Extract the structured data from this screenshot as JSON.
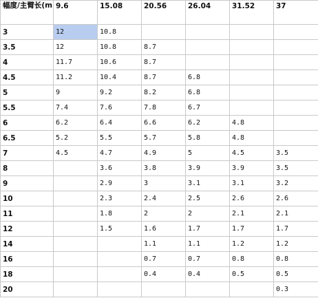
{
  "table": {
    "corner_label": "幅度/主臂长(m)",
    "columns": [
      "9.6",
      "15.08",
      "20.56",
      "26.04",
      "31.52",
      "37"
    ],
    "selected_cell": [
      0,
      0
    ],
    "rows": [
      {
        "label": "3",
        "cells": [
          "12",
          "10.8",
          "",
          "",
          "",
          ""
        ]
      },
      {
        "label": "3.5",
        "cells": [
          "12",
          "10.8",
          "8.7",
          "",
          "",
          ""
        ]
      },
      {
        "label": "4",
        "cells": [
          "11.7",
          "10.6",
          "8.7",
          "",
          "",
          ""
        ]
      },
      {
        "label": "4.5",
        "cells": [
          "11.2",
          "10.4",
          "8.7",
          "6.8",
          "",
          ""
        ]
      },
      {
        "label": "5",
        "cells": [
          "9",
          "9.2",
          "8.2",
          "6.8",
          "",
          ""
        ]
      },
      {
        "label": "5.5",
        "cells": [
          "7.4",
          "7.6",
          "7.8",
          "6.7",
          "",
          ""
        ]
      },
      {
        "label": "6",
        "cells": [
          "6.2",
          "6.4",
          "6.6",
          "6.2",
          "4.8",
          ""
        ]
      },
      {
        "label": "6.5",
        "cells": [
          "5.2",
          "5.5",
          "5.7",
          "5.8",
          "4.8",
          ""
        ]
      },
      {
        "label": "7",
        "cells": [
          "4.5",
          "4.7",
          "4.9",
          "5",
          "4.5",
          "3.5"
        ]
      },
      {
        "label": "8",
        "cells": [
          "",
          "3.6",
          "3.8",
          "3.9",
          "3.9",
          "3.5"
        ]
      },
      {
        "label": "9",
        "cells": [
          "",
          "2.9",
          "3",
          "3.1",
          "3.1",
          "3.2"
        ]
      },
      {
        "label": "10",
        "cells": [
          "",
          "2.3",
          "2.4",
          "2.5",
          "2.6",
          "2.6"
        ]
      },
      {
        "label": "11",
        "cells": [
          "",
          "1.8",
          "2",
          "2",
          "2.1",
          "2.1"
        ]
      },
      {
        "label": "12",
        "cells": [
          "",
          "1.5",
          "1.6",
          "1.7",
          "1.7",
          "1.7"
        ]
      },
      {
        "label": "14",
        "cells": [
          "",
          "",
          "1.1",
          "1.1",
          "1.2",
          "1.2"
        ]
      },
      {
        "label": "16",
        "cells": [
          "",
          "",
          "0.7",
          "0.7",
          "0.8",
          "0.8"
        ]
      },
      {
        "label": "18",
        "cells": [
          "",
          "",
          "0.4",
          "0.4",
          "0.5",
          "0.5"
        ]
      },
      {
        "label": "20",
        "cells": [
          "",
          "",
          "",
          "",
          "",
          "0.3"
        ]
      }
    ]
  },
  "colors": {
    "selection": "#b9cdf0",
    "grid": "#c8c8c8"
  }
}
